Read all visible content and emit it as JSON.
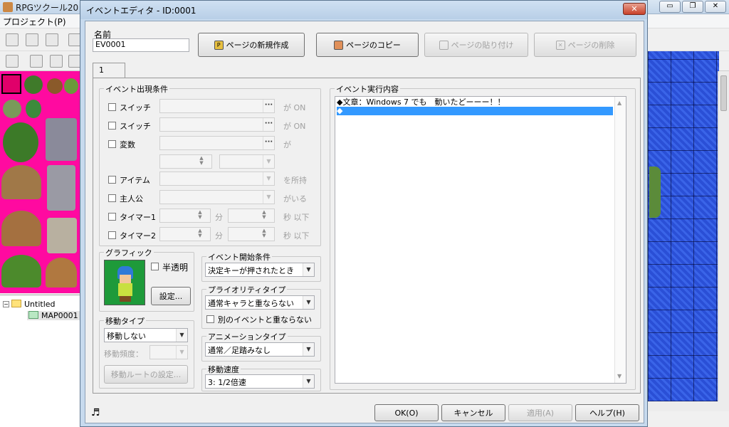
{
  "main_app": {
    "title": "RPGツクール20",
    "menu": [
      "プロジェクト(P)"
    ],
    "tree": {
      "root": "Untitled",
      "maps": [
        "MAP0001"
      ]
    },
    "window_buttons": {
      "minimize": "▭",
      "restore": "❐",
      "close": "✕"
    }
  },
  "dialog": {
    "title": "イベントエディタ - ID:0001",
    "close_label": "✕",
    "name_label": "名前",
    "name_value": "EV0001",
    "page_buttons": {
      "new": "ページの新規作成",
      "copy": "ページのコピー",
      "paste": "ページの貼り付け",
      "delete": "ページの削除"
    },
    "page_tabs": [
      "1"
    ],
    "conditions": {
      "title": "イベント出現条件",
      "rows": [
        {
          "label": "スイッチ",
          "suffix": "が ON"
        },
        {
          "label": "スイッチ",
          "suffix": "が ON"
        },
        {
          "label": "変数",
          "suffix": "が"
        },
        {
          "label": "アイテム",
          "suffix": "を所持"
        },
        {
          "label": "主人公",
          "suffix": "がいる"
        },
        {
          "label": "タイマー1",
          "mid": "分",
          "suffix": "秒 以下"
        },
        {
          "label": "タイマー2",
          "mid": "分",
          "suffix": "秒 以下"
        }
      ]
    },
    "graphic": {
      "title": "グラフィック",
      "translucent_label": "半透明",
      "settings_button": "設定..."
    },
    "start_condition": {
      "title": "イベント開始条件",
      "value": "決定キーが押されたとき"
    },
    "priority": {
      "title": "プライオリティタイプ",
      "value": "通常キャラと重ならない",
      "no_overlap_label": "別のイベントと重ならない"
    },
    "animation": {
      "title": "アニメーションタイプ",
      "value": "通常／足踏みなし"
    },
    "move_speed": {
      "title": "移動速度",
      "value": "3: 1/2倍速"
    },
    "move_type": {
      "title": "移動タイプ",
      "value": "移動しない",
      "frequency_label": "移動頻度：",
      "route_button": "移動ルートの設定..."
    },
    "commands": {
      "title": "イベント実行内容",
      "lines": [
        "◆文章：Windows 7 でも　動いたどーーー！！",
        "◆"
      ]
    },
    "footer": {
      "ok": "OK(O)",
      "cancel": "キャンセル",
      "apply": "適用(A)",
      "help": "ヘルプ(H)",
      "music_icon": "♬"
    }
  }
}
